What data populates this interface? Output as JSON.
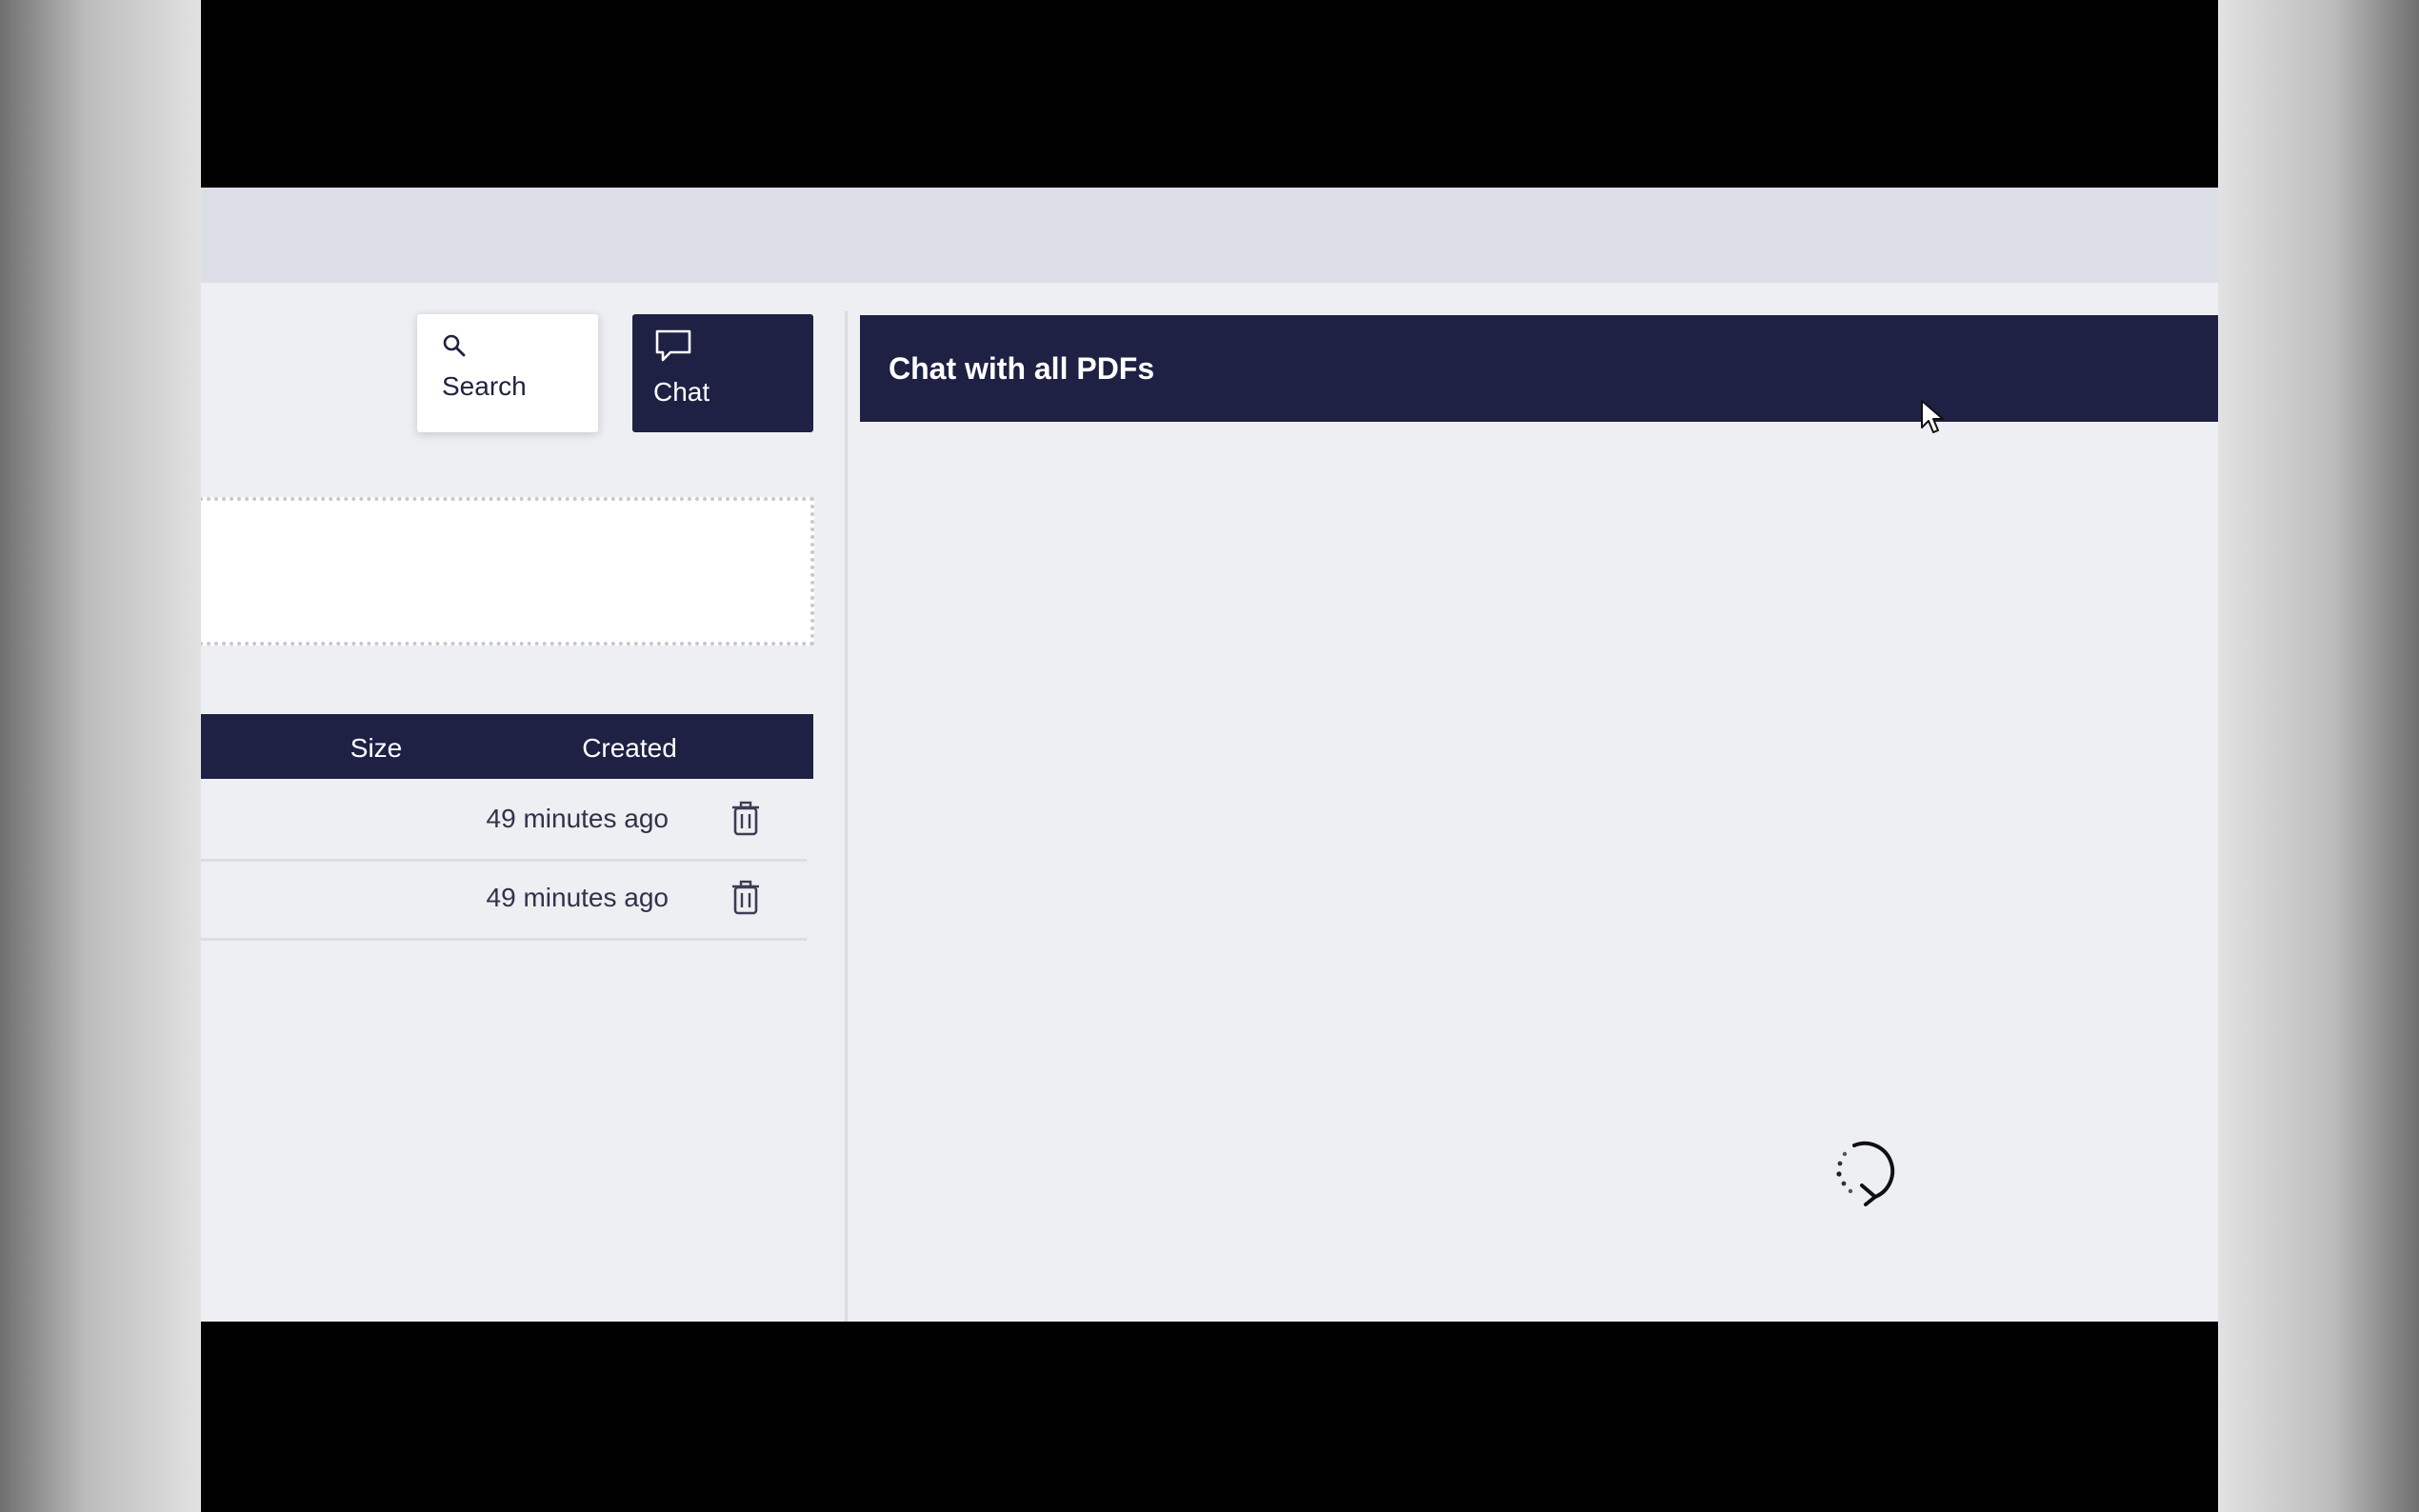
{
  "toolbar": {
    "search_label": "Search",
    "search_icon": "search-icon",
    "chat_label": "Chat",
    "chat_icon": "chat-bubble-icon"
  },
  "files_table": {
    "columns": [
      "Size",
      "Created"
    ],
    "rows": [
      {
        "size": "",
        "created": "49 minutes ago",
        "action_icon": "trash-icon"
      },
      {
        "size": "",
        "created": "49 minutes ago",
        "action_icon": "trash-icon"
      }
    ]
  },
  "chat_panel": {
    "title": "Chat with all PDFs",
    "status_icon": "loading-spinner-icon"
  },
  "colors": {
    "navy": "#1e2143",
    "panel_bg": "#eeeff2",
    "topbar_bg": "#dcdfe8",
    "white": "#ffffff"
  }
}
